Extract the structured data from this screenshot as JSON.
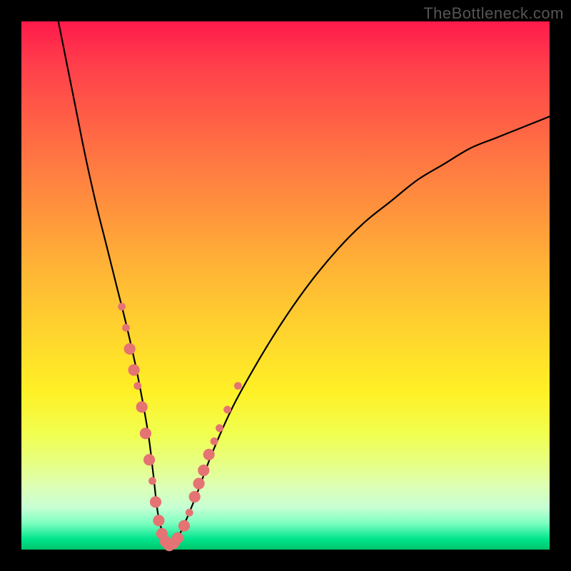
{
  "watermark": "TheBottleneck.com",
  "chart_data": {
    "type": "line",
    "title": "",
    "xlabel": "",
    "ylabel": "",
    "xlim": [
      0,
      100
    ],
    "ylim": [
      0,
      100
    ],
    "grid": false,
    "series": [
      {
        "name": "bottleneck-curve",
        "x": [
          7,
          10,
          12,
          14,
          16,
          18,
          20,
          22,
          24,
          25,
          26,
          28,
          30,
          33,
          36,
          40,
          45,
          50,
          55,
          60,
          65,
          70,
          75,
          80,
          85,
          90,
          95,
          100
        ],
        "values": [
          100,
          85,
          75,
          66,
          58,
          50,
          42,
          33,
          22,
          14,
          6,
          0,
          3,
          10,
          18,
          27,
          36,
          44,
          51,
          57,
          62,
          66,
          70,
          73,
          76,
          78,
          80,
          82
        ]
      }
    ],
    "markers": {
      "name": "rate-points",
      "color": "#e57373",
      "points": [
        {
          "x": 19.0,
          "y": 46.0,
          "r": 1.2
        },
        {
          "x": 19.8,
          "y": 42.0,
          "r": 1.2
        },
        {
          "x": 20.5,
          "y": 38.0,
          "r": 1.8
        },
        {
          "x": 21.3,
          "y": 34.0,
          "r": 1.8
        },
        {
          "x": 22.0,
          "y": 31.0,
          "r": 1.2
        },
        {
          "x": 22.8,
          "y": 27.0,
          "r": 1.8
        },
        {
          "x": 23.5,
          "y": 22.0,
          "r": 1.8
        },
        {
          "x": 24.2,
          "y": 17.0,
          "r": 1.8
        },
        {
          "x": 24.8,
          "y": 13.0,
          "r": 1.2
        },
        {
          "x": 25.4,
          "y": 9.0,
          "r": 1.8
        },
        {
          "x": 26.0,
          "y": 5.5,
          "r": 1.8
        },
        {
          "x": 26.6,
          "y": 3.0,
          "r": 1.8
        },
        {
          "x": 27.3,
          "y": 1.5,
          "r": 1.8
        },
        {
          "x": 28.0,
          "y": 0.8,
          "r": 1.8
        },
        {
          "x": 28.8,
          "y": 1.2,
          "r": 1.8
        },
        {
          "x": 29.6,
          "y": 2.2,
          "r": 1.8
        },
        {
          "x": 30.8,
          "y": 4.5,
          "r": 1.8
        },
        {
          "x": 31.8,
          "y": 7.0,
          "r": 1.2
        },
        {
          "x": 32.8,
          "y": 10.0,
          "r": 1.8
        },
        {
          "x": 33.6,
          "y": 12.5,
          "r": 1.8
        },
        {
          "x": 34.5,
          "y": 15.0,
          "r": 1.8
        },
        {
          "x": 35.5,
          "y": 18.0,
          "r": 1.8
        },
        {
          "x": 36.5,
          "y": 20.5,
          "r": 1.2
        },
        {
          "x": 37.5,
          "y": 23.0,
          "r": 1.2
        },
        {
          "x": 39.0,
          "y": 26.5,
          "r": 1.2
        },
        {
          "x": 41.0,
          "y": 31.0,
          "r": 1.2
        }
      ]
    }
  }
}
